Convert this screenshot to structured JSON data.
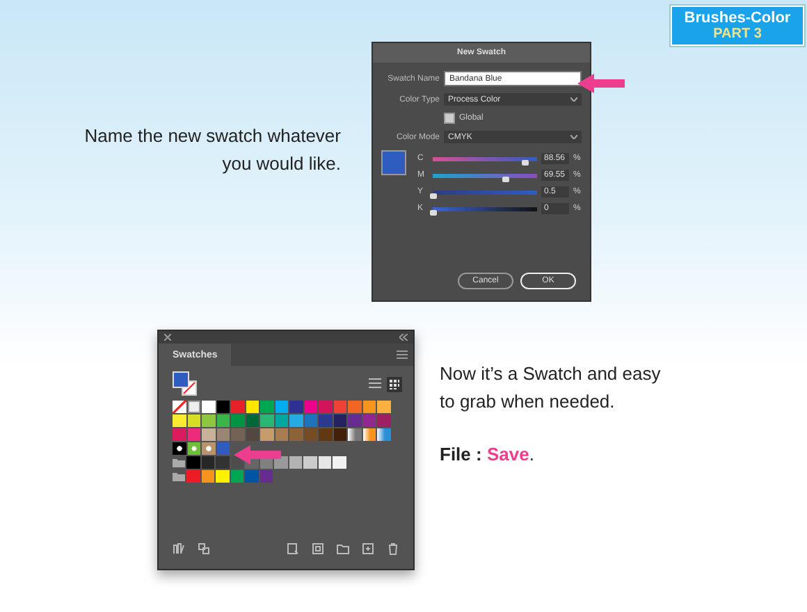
{
  "badge": {
    "title": "Brushes-Color",
    "subtitle": "PART 3"
  },
  "left_caption": "Name the new swatch whatever you would like.",
  "new_swatch_dialog": {
    "title": "New Swatch",
    "swatch_name": {
      "label": "Swatch Name",
      "value": "Bandana Blue"
    },
    "color_type": {
      "label": "Color Type",
      "value": "Process Color"
    },
    "global": {
      "label": "Global",
      "checked": true
    },
    "color_mode": {
      "label": "Color Mode",
      "value": "CMYK"
    },
    "channels": [
      {
        "name": "C",
        "level": 0.8856,
        "reading": "88.56",
        "unit": "%"
      },
      {
        "name": "M",
        "level": 0.6955,
        "reading": "69.55",
        "unit": "%"
      },
      {
        "name": "Y",
        "level": 0.005,
        "reading": "0.5",
        "unit": "%"
      },
      {
        "name": "K",
        "level": 0,
        "reading": "0",
        "unit": "%"
      }
    ],
    "buttons": [
      {
        "label": "Cancel",
        "selected": false
      },
      {
        "label": "OK",
        "selected": true
      }
    ]
  },
  "swatches_panel": {
    "tab": "Swatches",
    "rows": [
      [
        {
          "kind": "none"
        },
        {
          "kind": "registration"
        },
        {
          "kind": "solid",
          "color": "#ffffff"
        },
        {
          "kind": "solid",
          "color": "#000000"
        },
        {
          "kind": "solid",
          "color": "#e8202a"
        },
        {
          "kind": "solid",
          "color": "#ffe600"
        },
        {
          "kind": "solid",
          "color": "#00a651"
        },
        {
          "kind": "solid",
          "color": "#00aeef"
        },
        {
          "kind": "solid",
          "color": "#2e3192"
        },
        {
          "kind": "solid",
          "color": "#ec008c"
        },
        {
          "kind": "solid",
          "color": "#d4145a"
        },
        {
          "kind": "solid",
          "color": "#ef4136"
        },
        {
          "kind": "solid",
          "color": "#f26522"
        },
        {
          "kind": "solid",
          "color": "#f7941d"
        },
        {
          "kind": "solid",
          "color": "#fbb040"
        }
      ],
      [
        {
          "kind": "solid",
          "color": "#f9ed32"
        },
        {
          "kind": "solid",
          "color": "#d7df23"
        },
        {
          "kind": "solid",
          "color": "#8dc63f"
        },
        {
          "kind": "solid",
          "color": "#39b54a"
        },
        {
          "kind": "solid",
          "color": "#009444"
        },
        {
          "kind": "solid",
          "color": "#006838"
        },
        {
          "kind": "solid",
          "color": "#2bb673"
        },
        {
          "kind": "solid",
          "color": "#00a79d"
        },
        {
          "kind": "solid",
          "color": "#27aae1"
        },
        {
          "kind": "solid",
          "color": "#1c75bc"
        },
        {
          "kind": "solid",
          "color": "#2b3990"
        },
        {
          "kind": "solid",
          "color": "#262262"
        },
        {
          "kind": "solid",
          "color": "#662d91"
        },
        {
          "kind": "solid",
          "color": "#92278f"
        },
        {
          "kind": "solid",
          "color": "#9e1f63"
        }
      ],
      [
        {
          "kind": "solid",
          "color": "#da1c5c"
        },
        {
          "kind": "solid",
          "color": "#ee2a7b"
        },
        {
          "kind": "solid",
          "color": "#c7b299"
        },
        {
          "kind": "solid",
          "color": "#998675"
        },
        {
          "kind": "solid",
          "color": "#736357"
        },
        {
          "kind": "solid",
          "color": "#534741"
        },
        {
          "kind": "solid",
          "color": "#c69c6d"
        },
        {
          "kind": "solid",
          "color": "#a67c52"
        },
        {
          "kind": "solid",
          "color": "#8c6239"
        },
        {
          "kind": "solid",
          "color": "#754c24"
        },
        {
          "kind": "solid",
          "color": "#603913"
        },
        {
          "kind": "solid",
          "color": "#42210b"
        },
        {
          "kind": "gradient",
          "color": "#777777"
        },
        {
          "kind": "gradient",
          "color": "#f7931e"
        },
        {
          "kind": "gradient",
          "color": "#2b8fd6"
        }
      ],
      [
        {
          "kind": "pattern",
          "color": "#000000"
        },
        {
          "kind": "pattern",
          "color": "#6fbf3a"
        },
        {
          "kind": "pattern",
          "color": "#b9946a"
        },
        {
          "kind": "solid",
          "color": "#2f5dbf"
        }
      ],
      [
        {
          "kind": "folder"
        },
        {
          "kind": "solid",
          "color": "#000000"
        },
        {
          "kind": "solid",
          "color": "#262626"
        },
        {
          "kind": "solid",
          "color": "#333333"
        },
        {
          "kind": "solid",
          "color": "#4d4d4d"
        },
        {
          "kind": "solid",
          "color": "#666666"
        },
        {
          "kind": "solid",
          "color": "#808080"
        },
        {
          "kind": "solid",
          "color": "#999999"
        },
        {
          "kind": "solid",
          "color": "#b3b3b3"
        },
        {
          "kind": "solid",
          "color": "#cccccc"
        },
        {
          "kind": "solid",
          "color": "#e6e6e6"
        },
        {
          "kind": "solid",
          "color": "#f2f2f2"
        }
      ],
      [
        {
          "kind": "folder"
        },
        {
          "kind": "solid",
          "color": "#ed1c24"
        },
        {
          "kind": "solid",
          "color": "#f7931e"
        },
        {
          "kind": "solid",
          "color": "#fff200"
        },
        {
          "kind": "solid",
          "color": "#00a651"
        },
        {
          "kind": "solid",
          "color": "#0054a6"
        },
        {
          "kind": "solid",
          "color": "#662d91"
        }
      ]
    ]
  },
  "right_caption": "Now it’s a Swatch and easy to grab when needed.",
  "save_line": {
    "label": "File :",
    "command": "Save",
    "end": "."
  }
}
